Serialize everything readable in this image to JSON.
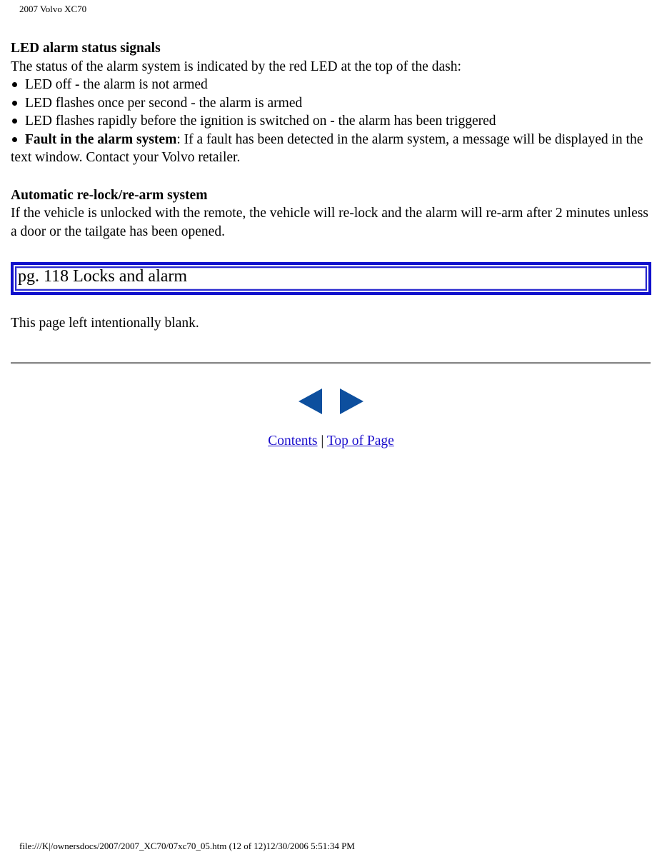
{
  "header": {
    "title": "2007 Volvo XC70"
  },
  "led_section": {
    "heading": "LED alarm status signals",
    "intro": "The status of the alarm system is indicated by the red LED at the top of the dash:",
    "bullets": [
      {
        "text": "LED off - the alarm is not armed"
      },
      {
        "text": "LED flashes once per second - the alarm is armed"
      },
      {
        "text": "LED flashes rapidly before the ignition is switched on - the alarm has been triggered"
      },
      {
        "bold": "Fault in the alarm system",
        "text": ": If a fault has been detected in the alarm system, a message will be displayed in the text window. Contact your Volvo retailer."
      }
    ]
  },
  "relock_section": {
    "heading": "Automatic re-lock/re-arm system",
    "body": "If the vehicle is unlocked with the remote, the vehicle will re-lock and the alarm will re-arm after 2 minutes unless a door or the tailgate has been opened."
  },
  "page_box": {
    "label": "pg. 118 Locks and alarm"
  },
  "blank_note": "This page left intentionally blank.",
  "nav": {
    "prev_icon": "previous-arrow-icon",
    "next_icon": "next-arrow-icon",
    "color": "#0d4f9e"
  },
  "footer_links": {
    "contents": "Contents",
    "separator": "|",
    "top_of_page": "Top of Page"
  },
  "file_footer": "file:///K|/ownersdocs/2007/2007_XC70/07xc70_05.htm (12 of 12)12/30/2006 5:51:34 PM"
}
